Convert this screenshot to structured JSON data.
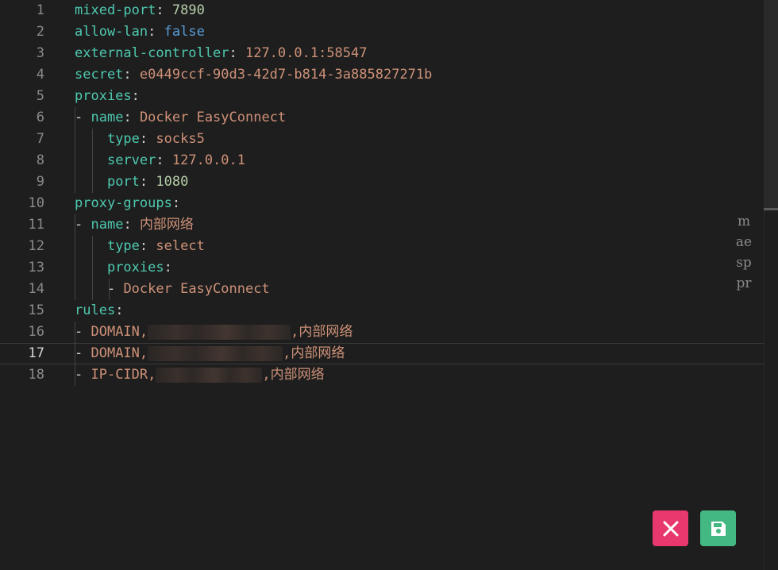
{
  "editor": {
    "current_line": "17",
    "lines": [
      {
        "num": "1",
        "indent": 0,
        "key": "mixed-port",
        "value": "7890",
        "vtype": "n"
      },
      {
        "num": "2",
        "indent": 0,
        "key": "allow-lan",
        "value": "false",
        "vtype": "b"
      },
      {
        "num": "3",
        "indent": 0,
        "key": "external-controller",
        "value": "127.0.0.1:58547",
        "vtype": "s"
      },
      {
        "num": "4",
        "indent": 0,
        "key": "secret",
        "value": "e0449ccf-90d3-42d7-b814-3a885827271b",
        "vtype": "s"
      },
      {
        "num": "5",
        "indent": 0,
        "key": "proxies",
        "value": "",
        "vtype": ""
      },
      {
        "num": "6",
        "indent": 1,
        "dash": true,
        "key": "name",
        "value": "Docker EasyConnect",
        "vtype": "s"
      },
      {
        "num": "7",
        "indent": 2,
        "key": "type",
        "value": "socks5",
        "vtype": "s"
      },
      {
        "num": "8",
        "indent": 2,
        "key": "server",
        "value": "127.0.0.1",
        "vtype": "s"
      },
      {
        "num": "9",
        "indent": 2,
        "key": "port",
        "value": "1080",
        "vtype": "n"
      },
      {
        "num": "10",
        "indent": 0,
        "key": "proxy-groups",
        "value": "",
        "vtype": ""
      },
      {
        "num": "11",
        "indent": 1,
        "dash": true,
        "key": "name",
        "value": "内部网络",
        "vtype": "s"
      },
      {
        "num": "12",
        "indent": 2,
        "key": "type",
        "value": "select",
        "vtype": "s"
      },
      {
        "num": "13",
        "indent": 2,
        "key": "proxies",
        "value": "",
        "vtype": ""
      },
      {
        "num": "14",
        "indent": 3,
        "dash": true,
        "item": "Docker EasyConnect",
        "itype": "s"
      },
      {
        "num": "15",
        "indent": 0,
        "key": "rules",
        "value": "",
        "vtype": ""
      },
      {
        "num": "16",
        "indent": 1,
        "dash": true,
        "rule_prefix": "DOMAIN,",
        "redacted_width": 180,
        "rule_suffix": ",内部网络"
      },
      {
        "num": "17",
        "indent": 1,
        "dash": true,
        "rule_prefix": "DOMAIN,",
        "redacted_width": 170,
        "rule_suffix": ",内部网络"
      },
      {
        "num": "18",
        "indent": 1,
        "dash": true,
        "rule_prefix": "IP-CIDR,",
        "redacted_width": 134,
        "rule_suffix": ",内部网络"
      }
    ]
  },
  "minimap_label": "maesppr",
  "buttons": {
    "cancel": {
      "icon": "close-icon",
      "color": "#e8386d"
    },
    "save": {
      "icon": "save-icon",
      "color": "#44b883"
    }
  },
  "colors": {
    "background": "#1e1e1e",
    "key": "#4ec9b0",
    "string": "#ce9178",
    "number": "#b5cea8",
    "boolean": "#569cd6"
  }
}
